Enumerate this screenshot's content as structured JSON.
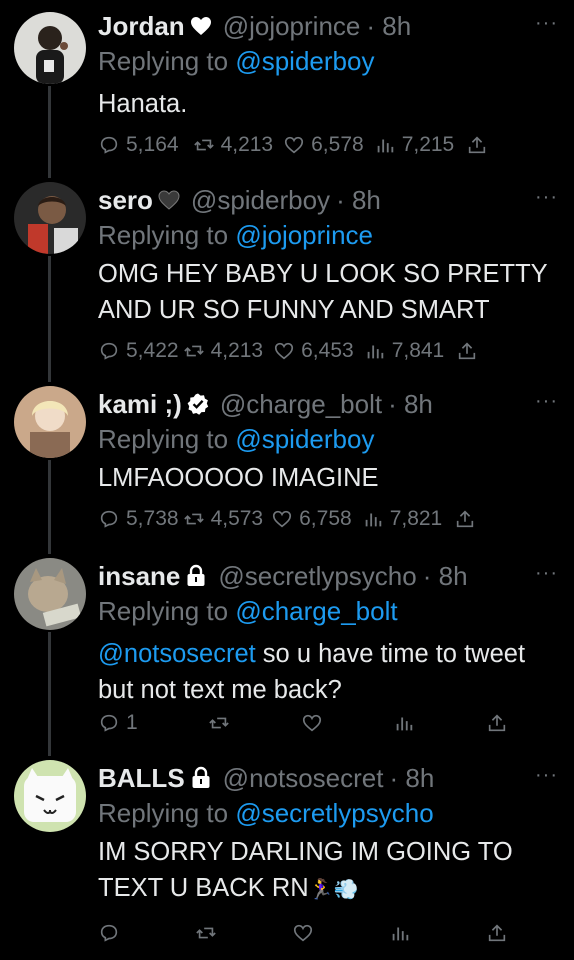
{
  "colors": {
    "background": "#000000",
    "text": "#e7e9ea",
    "muted": "#71767b",
    "link": "#1d9bf0",
    "thread_line": "#333639"
  },
  "tweets": [
    {
      "name": "Jordan",
      "badge": "black-heart-emoji",
      "handle": "@jojoprince",
      "time": "· 8h",
      "replying_prefix": "Replying to",
      "replying_to": "@spiderboy",
      "text": "Hanata.",
      "replies": "5,164",
      "retweets": "4,213",
      "likes": "6,578",
      "views": "7,215"
    },
    {
      "name": "sero",
      "badge": "black-heart-emoji",
      "handle": "@spiderboy",
      "time": "· 8h",
      "replying_prefix": "Replying to",
      "replying_to": "@jojoprince",
      "text": "OMG HEY BABY U LOOK SO PRETTY AND UR SO FUNNY AND SMART",
      "replies": "5,422",
      "retweets": "4,213",
      "likes": "6,453",
      "views": "7,841"
    },
    {
      "name": "kami ;)",
      "badge": "verified-icon",
      "handle": "@charge_bolt",
      "time": "· 8h",
      "replying_prefix": "Replying to",
      "replying_to": "@spiderboy",
      "text": "LMFAOOOOO IMAGINE",
      "replies": "5,738",
      "retweets": "4,573",
      "likes": "6,758",
      "views": "7,821"
    },
    {
      "name": "insane",
      "badge": "lock-icon",
      "handle": "@secretlypsycho",
      "time": "· 8h",
      "replying_prefix": "Replying to",
      "replying_to": "@charge_bolt",
      "text_mention": "@notsosecret",
      "text": " so u have time to tweet but not text me back?",
      "replies": "1",
      "retweets": "",
      "likes": "",
      "views": ""
    },
    {
      "name": "BALLS",
      "badge": "lock-icon",
      "handle": "@notsosecret",
      "time": "· 8h",
      "replying_prefix": "Replying to",
      "replying_to": "@secretlypsycho",
      "text": "IM SORRY DARLING IM GOING TO TEXT U BACK RN",
      "text_emoji": "🏃‍♀️💨",
      "replies": "",
      "retweets": "",
      "likes": "",
      "views": ""
    }
  ],
  "more_label": "···"
}
